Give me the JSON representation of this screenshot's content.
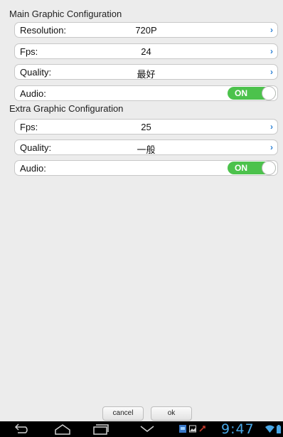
{
  "main": {
    "title": "Main Graphic Configuration",
    "resolution": {
      "label": "Resolution:",
      "value": "720P"
    },
    "fps": {
      "label": "Fps:",
      "value": "24"
    },
    "quality": {
      "label": "Quality:",
      "value": "最好"
    },
    "audio": {
      "label": "Audio:",
      "toggle": "ON"
    }
  },
  "extra": {
    "title": "Extra Graphic Configuration",
    "fps": {
      "label": "Fps:",
      "value": "25"
    },
    "quality": {
      "label": "Quality:",
      "value": "一般"
    },
    "audio": {
      "label": "Audio:",
      "toggle": "ON"
    }
  },
  "buttons": {
    "cancel": "cancel",
    "ok": "ok"
  },
  "status": {
    "time": "9:47"
  },
  "colors": {
    "toggle_on": "#4cc24c",
    "chevron": "#2a7fd4",
    "clock": "#49a8e7"
  }
}
